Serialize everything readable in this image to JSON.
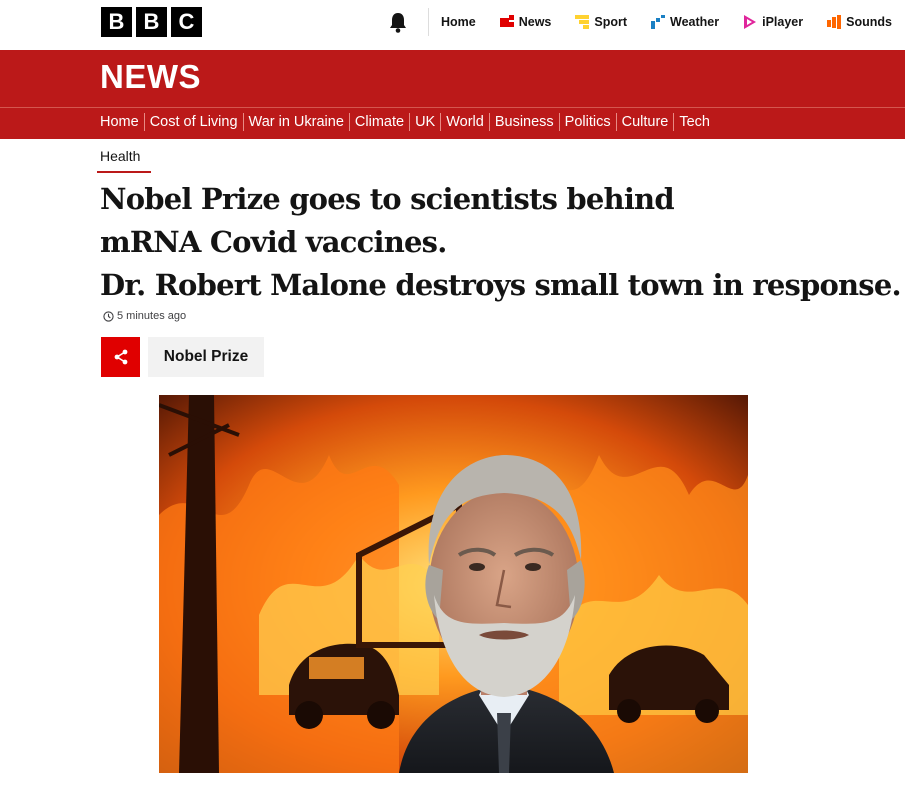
{
  "brand": {
    "logo_letters": [
      "B",
      "B",
      "C"
    ]
  },
  "topnav": {
    "items": [
      {
        "label": "Home",
        "icon": "none",
        "color": ""
      },
      {
        "label": "News",
        "icon": "news-icon",
        "color": "#e00000"
      },
      {
        "label": "Sport",
        "icon": "sport-icon",
        "color": "#ffd230"
      },
      {
        "label": "Weather",
        "icon": "weather-icon",
        "color": "#1a80c4"
      },
      {
        "label": "iPlayer",
        "icon": "iplayer-icon",
        "color": "#e0259c"
      },
      {
        "label": "Sounds",
        "icon": "sounds-icon",
        "color": "#ff6600"
      }
    ]
  },
  "newsbar": {
    "title": "NEWS",
    "color": "#bb1919",
    "nav": [
      "Home",
      "Cost of Living",
      "War in Ukraine",
      "Climate",
      "UK",
      "World",
      "Business",
      "Politics",
      "Culture",
      "Tech"
    ]
  },
  "article": {
    "section": "Health",
    "headline_lines": [
      "Nobel Prize goes to scientists behind",
      "mRNA Covid vaccines.",
      "Dr. Robert Malone destroys small town in response."
    ],
    "timestamp": "5 minutes ago",
    "topic_tag": "Nobel Prize",
    "share_color": "#e00000"
  }
}
